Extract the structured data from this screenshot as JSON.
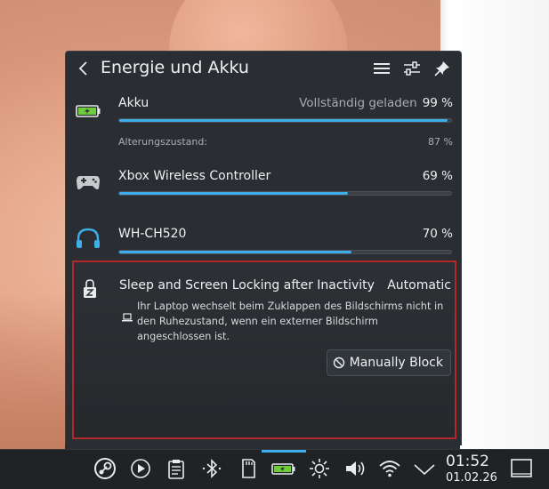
{
  "popup": {
    "title": "Energie und Akku",
    "header_icons": [
      "menu-icon",
      "configure-icon",
      "pin-icon"
    ]
  },
  "battery": {
    "name": "Akku",
    "status": "Vollständig geladen",
    "percent": "99 %",
    "level": 0.99,
    "health_label": "Alterungszustand:",
    "health_value": "87 %"
  },
  "controller": {
    "name": "Xbox Wireless Controller",
    "percent": "69 %",
    "level": 0.69
  },
  "headphones": {
    "name": "WH-CH520",
    "percent": "70 %",
    "level": 0.7
  },
  "sleep": {
    "title": "Sleep and Screen Locking after Inactivity",
    "mode": "Automatic",
    "note": "Ihr Laptop wechselt beim Zuklappen des Bildschirms nicht in den Ruhezustand, wenn ein externer Bildschirm angeschlossen ist.",
    "block_button": "Manually Block"
  },
  "taskbar": {
    "icons": [
      "steam-icon",
      "media-player-icon",
      "clipboard-icon",
      "bluetooth-icon",
      "sd-card-icon",
      "battery-icon",
      "brightness-icon",
      "volume-icon",
      "wifi-icon",
      "tray-expand-icon",
      "show-desktop-icon"
    ],
    "time": "01:52",
    "date": "01.02.26"
  },
  "colors": {
    "accent": "#3daee9",
    "highlight_border": "#b3262a",
    "battery_green": "#6ecb3c"
  }
}
